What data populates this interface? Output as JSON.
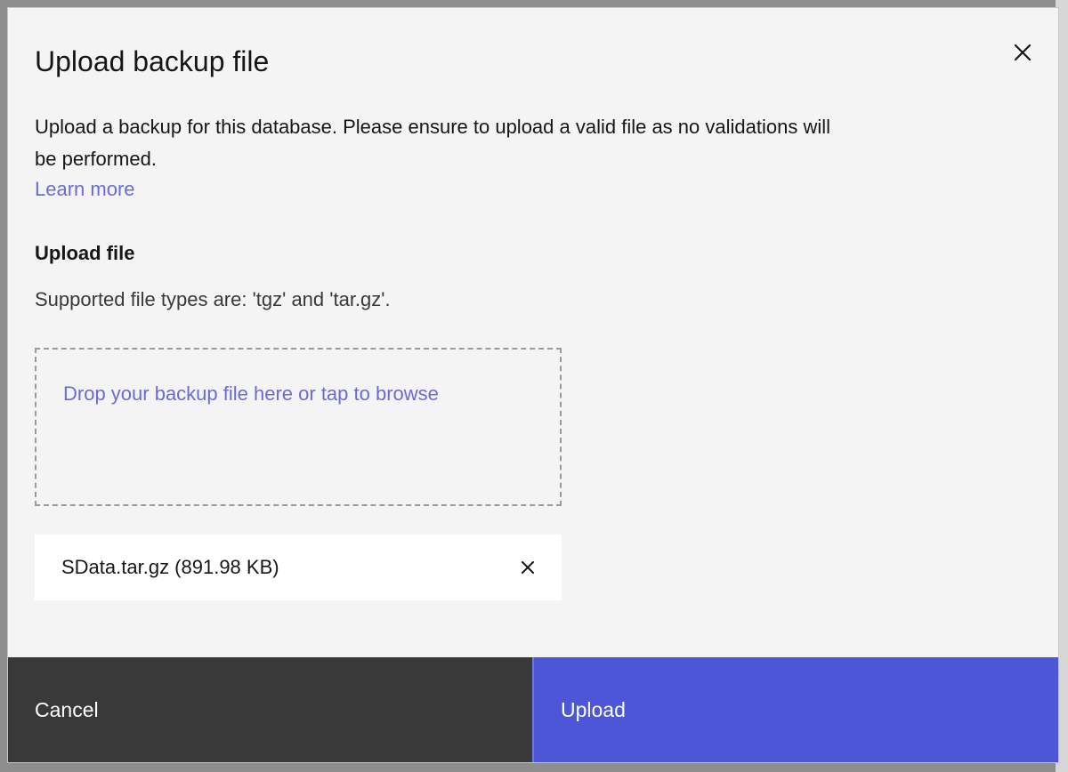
{
  "modal": {
    "title": "Upload backup file",
    "description": "Upload a backup for this database. Please ensure to upload a valid file as no validations will be performed.",
    "learn_more": "Learn more",
    "close_icon": "close-icon"
  },
  "upload": {
    "section_label": "Upload file",
    "helper_text": "Supported file types are: 'tgz' and 'tar.gz'.",
    "dropzone_text": "Drop your backup file here or tap to browse",
    "file": {
      "name": "SData.tar.gz (891.98 KB)",
      "remove_icon": "close-icon"
    }
  },
  "footer": {
    "cancel_label": "Cancel",
    "upload_label": "Upload"
  },
  "colors": {
    "link": "#6b6bd8",
    "primary": "#4e56d8",
    "secondary": "#393939",
    "modal_bg": "#f4f4f4"
  }
}
